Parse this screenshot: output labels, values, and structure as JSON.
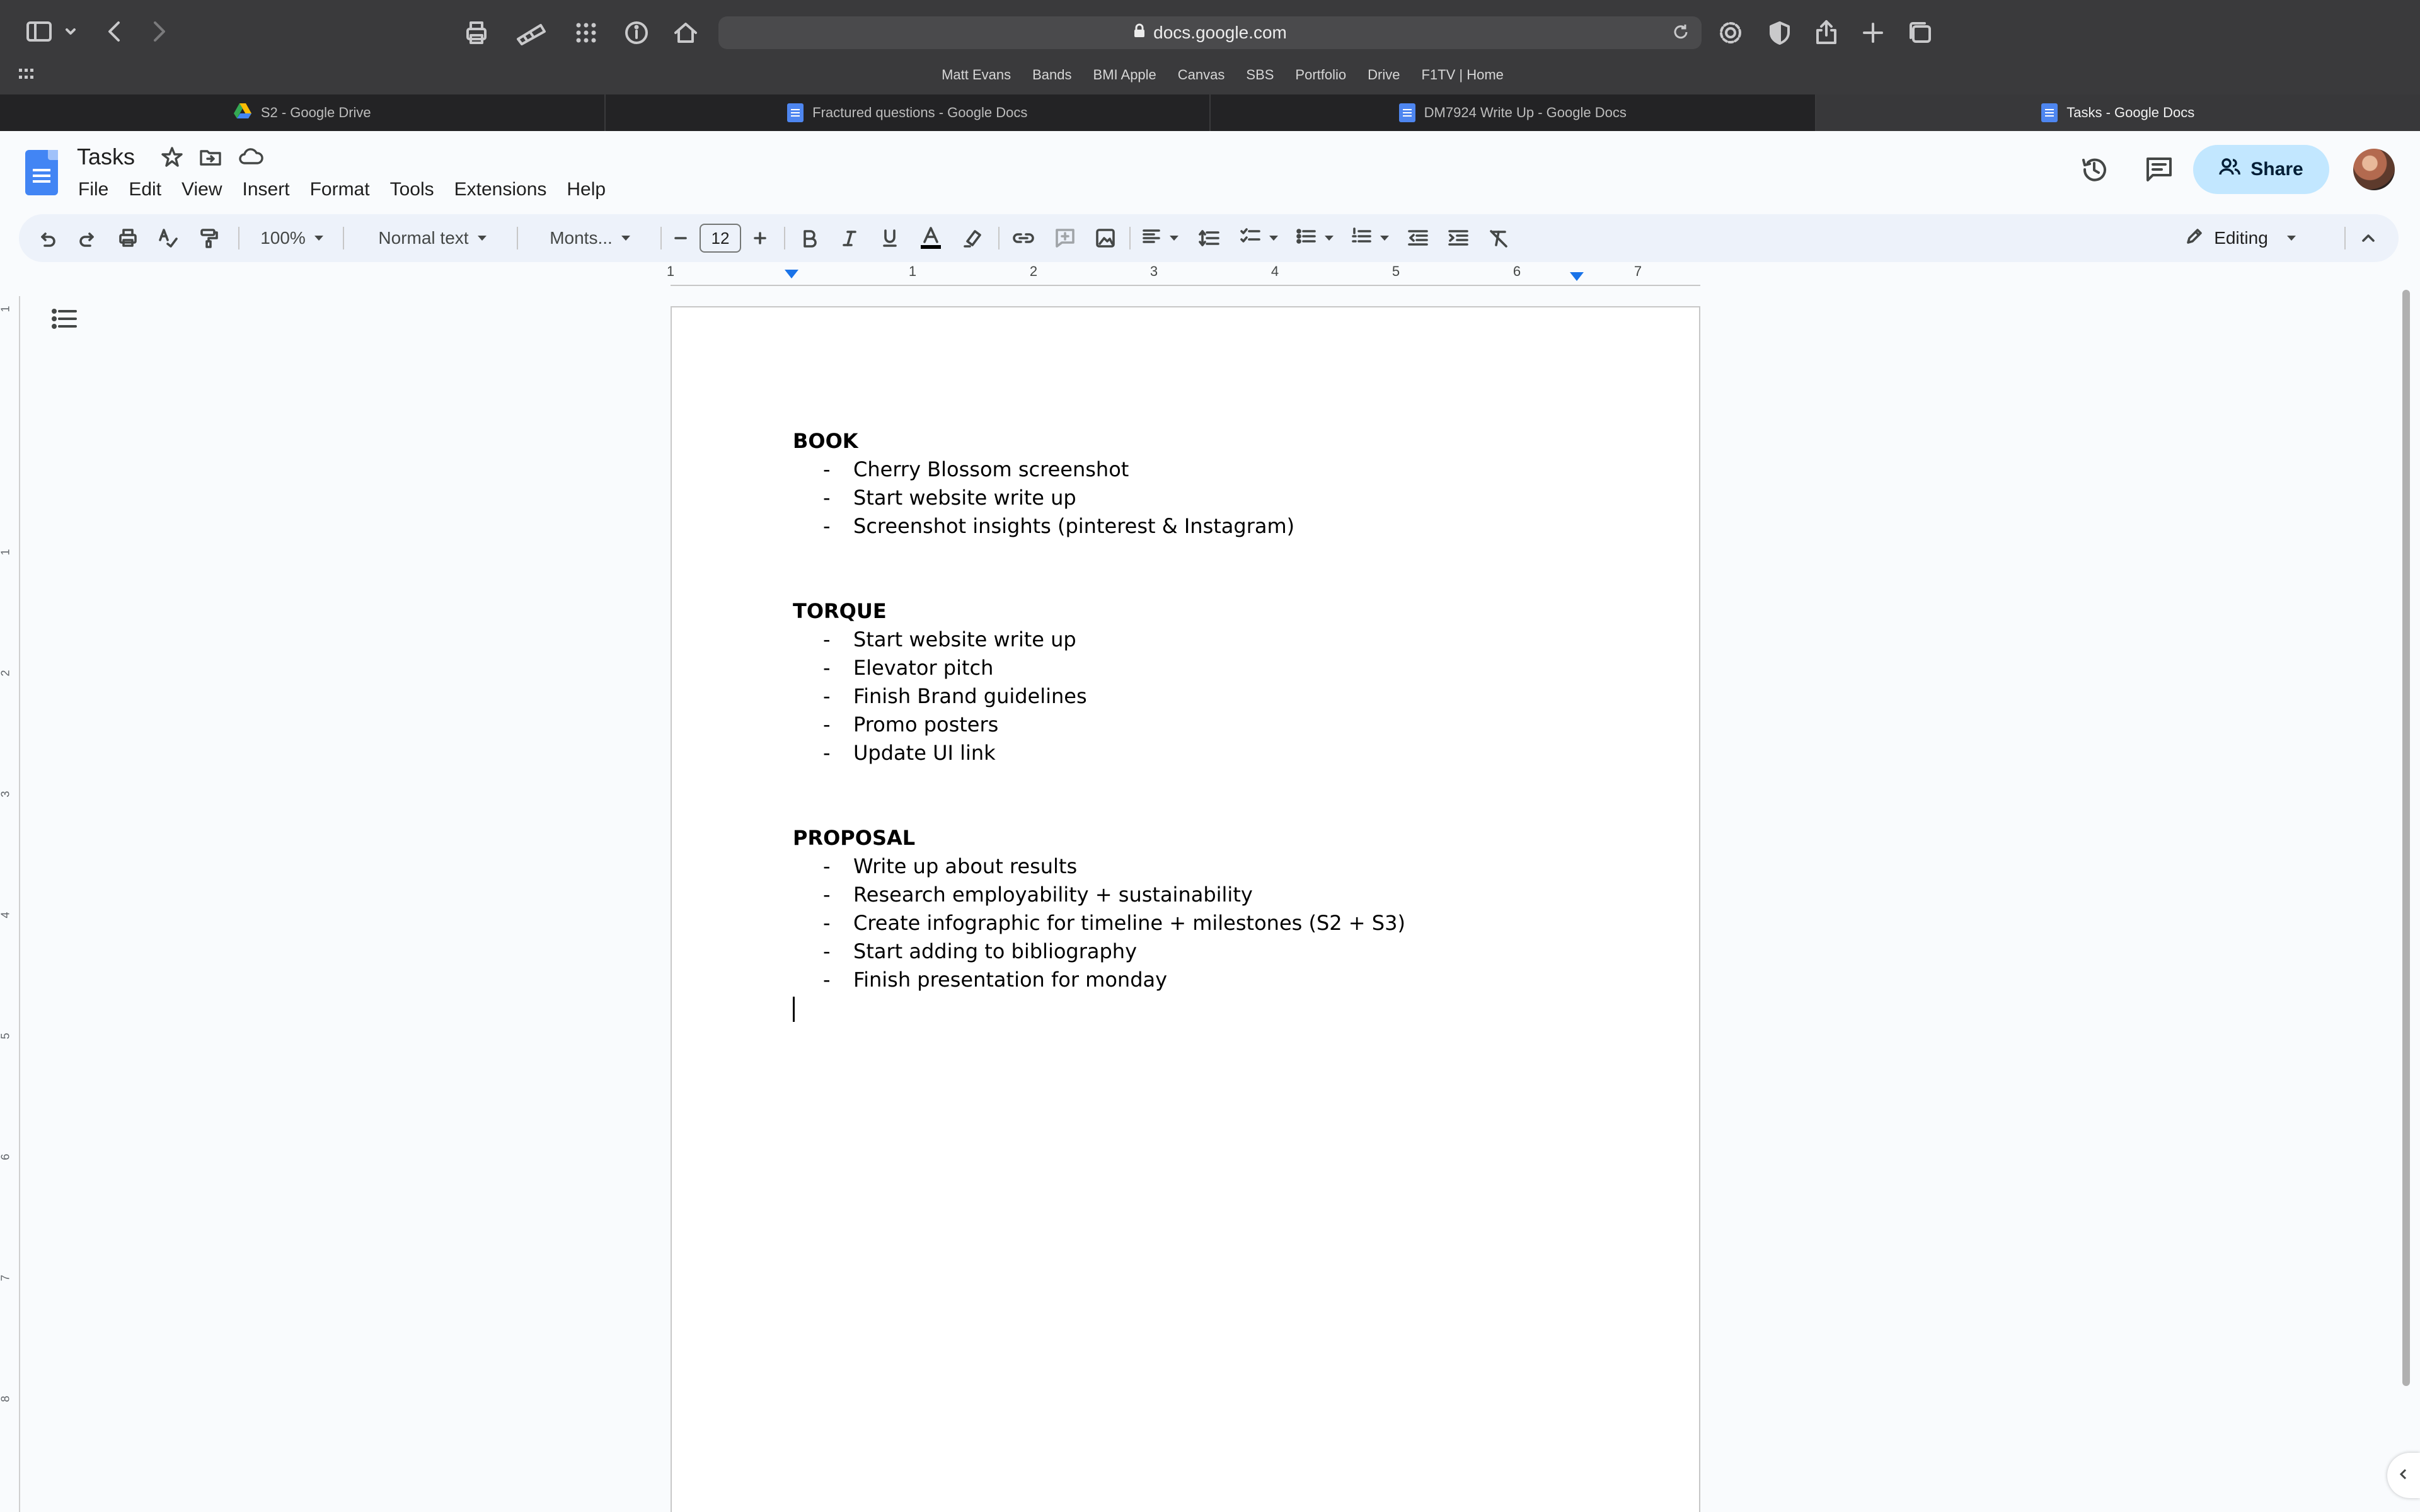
{
  "browser": {
    "url": "docs.google.com",
    "bookmarks": [
      "Matt Evans",
      "Bands",
      "BMI Apple",
      "Canvas",
      "SBS",
      "Portfolio",
      "Drive",
      "F1TV | Home"
    ],
    "tabs": [
      {
        "label": "S2 - Google Drive",
        "icon": "drive-icon",
        "active": false
      },
      {
        "label": "Fractured questions - Google Docs",
        "icon": "docs-icon",
        "active": false
      },
      {
        "label": "DM7924 Write Up - Google Docs",
        "icon": "docs-icon",
        "active": false
      },
      {
        "label": "Tasks - Google Docs",
        "icon": "docs-icon",
        "active": true
      }
    ]
  },
  "doc": {
    "title": "Tasks",
    "menu": [
      "File",
      "Edit",
      "View",
      "Insert",
      "Format",
      "Tools",
      "Extensions",
      "Help"
    ],
    "share_label": "Share"
  },
  "toolbar": {
    "zoom": "100%",
    "style": "Normal text",
    "font": "Monts...",
    "font_size": "12",
    "mode": "Editing",
    "text_color": "#000000"
  },
  "ruler": {
    "labels": [
      "1",
      "1",
      "2",
      "3",
      "4",
      "5",
      "6",
      "7"
    ],
    "vertical_labels": [
      "1",
      "1",
      "2",
      "3",
      "4",
      "5",
      "6",
      "7",
      "8"
    ]
  },
  "content": {
    "sections": [
      {
        "heading": "BOOK",
        "items": [
          "Cherry Blossom screenshot",
          "Start website write up",
          "Screenshot insights (pinterest & Instagram)"
        ]
      },
      {
        "heading": "TORQUE",
        "items": [
          "Start website write up",
          "Elevator pitch",
          "Finish Brand guidelines",
          "Promo posters",
          "Update UI link"
        ]
      },
      {
        "heading": "PROPOSAL",
        "items": [
          "Write up about results",
          "Research employability + sustainability",
          "Create infographic for timeline + milestones (S2 + S3)",
          "Start adding to bibliography",
          "Finish presentation for monday"
        ]
      }
    ],
    "bullet_symbol": "-"
  },
  "colors": {
    "share_bg": "#c2e7ff",
    "toolbar_bg": "#edf2fa",
    "accent": "#1a73e8"
  }
}
